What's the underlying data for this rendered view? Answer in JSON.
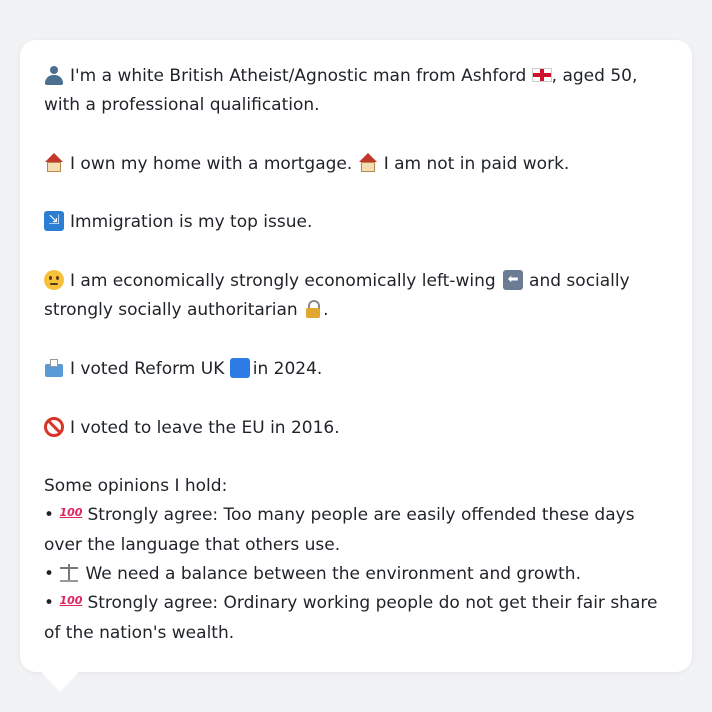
{
  "profile": {
    "line1": "I'm a white British Atheist/Agnostic man from Ashford",
    "line1_suffix": ", aged 50, with a professional qualification.",
    "home_text": "I own my home with a mortgage.",
    "work_text": "I am not in paid work.",
    "issue_text": "Immigration is my top issue.",
    "econ_text_a": "I am economically strongly economically left-wing",
    "econ_text_b": "and socially strongly socially authoritarian",
    "econ_text_end": ".",
    "vote_text_a": "I voted Reform UK",
    "vote_text_b": "in 2024.",
    "eu_text": "I voted to leave the EU in 2016."
  },
  "opinions": {
    "heading": "Some opinions I hold:",
    "bullet": "•",
    "items": [
      {
        "icon": "hundred-points-icon",
        "text": "Strongly agree: Too many people are easily offended these days over the language that others use."
      },
      {
        "icon": "balance-scale-icon",
        "text": "We need a balance between the environment and growth."
      },
      {
        "icon": "hundred-points-icon",
        "text": "Strongly agree: Ordinary working people do not get their fair share of the nation's wealth."
      }
    ]
  },
  "icons": {
    "person": "bust-in-silhouette-icon",
    "flag": "england-flag-icon",
    "house": "house-icon",
    "immigration": "passport-control-icon",
    "thinking": "thinking-face-icon",
    "left_arrow": "left-arrow-icon",
    "lock": "lock-icon",
    "ballot": "ballot-box-icon",
    "blue_square": "blue-square-icon",
    "no_entry": "prohibited-icon",
    "hundred_glyph": "100"
  },
  "colors": {
    "background": "#f1f2f4",
    "card": "#ffffff",
    "text": "#1f2328"
  }
}
